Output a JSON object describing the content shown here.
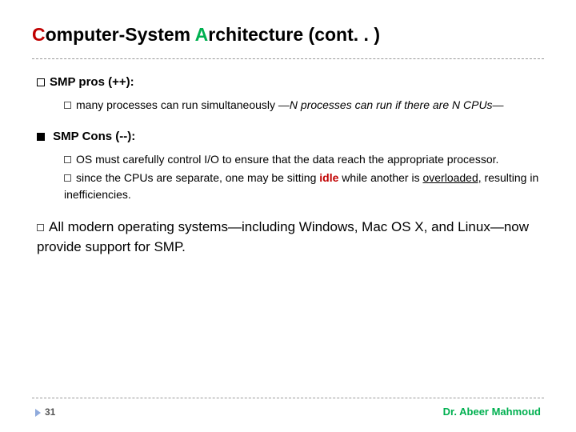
{
  "title": {
    "c1": "C",
    "part1": "omputer-System ",
    "c2": "A",
    "part2": "rchitecture (cont. . )"
  },
  "sections": {
    "pros": {
      "label_prefix": "SMP",
      "label_suffix": " pros (++):",
      "item1_pre": "many processes can run simultaneously ",
      "item1_em": "—N processes can run if there are N CPUs—",
      "item1_post": ""
    },
    "cons": {
      "label": " SMP Cons (--):",
      "item1": "OS must carefully control I/O to ensure that the data reach the appropriate processor.",
      "item2_pre": "since the CPUs are separate, one may be sitting ",
      "item2_idle": "idle",
      "item2_mid": " while another is ",
      "item2_over": "overloaded,",
      "item2_post": " resulting in inefficiencies."
    },
    "modern": {
      "pre": "All",
      "text": " modern operating systems—including Windows, Mac OS X, and Linux—now provide support for SMP."
    }
  },
  "footer": {
    "page": "31",
    "author": "Dr. Abeer Mahmoud"
  }
}
